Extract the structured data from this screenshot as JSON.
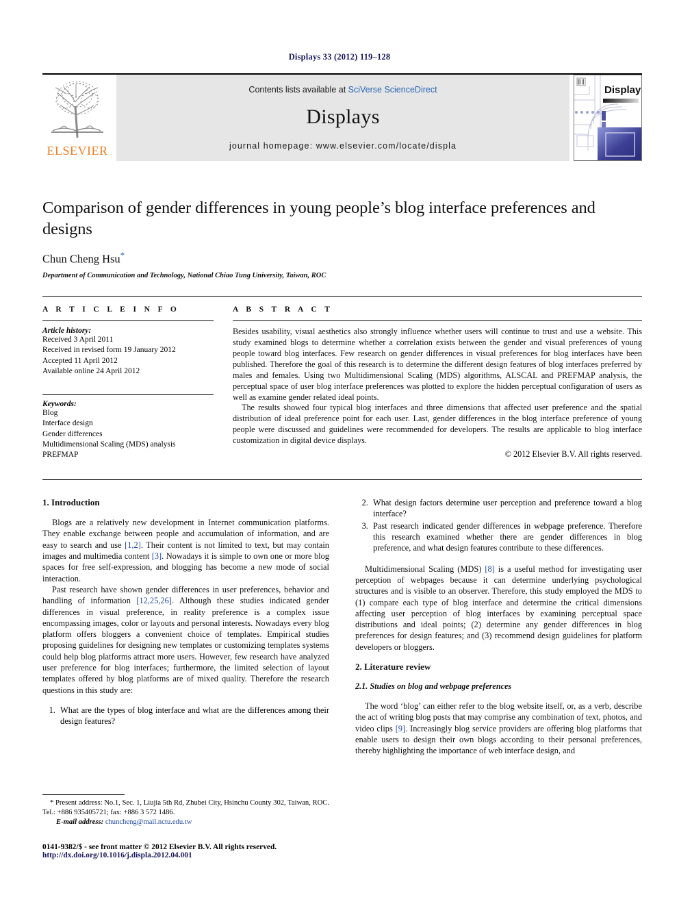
{
  "running_head": "Displays 33 (2012) 119–128",
  "masthead": {
    "publisher_wordmark": "ELSEVIER",
    "contents_prefix": "Contents lists available at ",
    "contents_link": "SciVerse ScienceDirect",
    "journal_name": "Displays",
    "homepage": "journal homepage: www.elsevier.com/locate/displa",
    "cover_title": "Displays"
  },
  "article": {
    "title": "Comparison of gender differences in young people’s blog interface preferences and designs",
    "author": "Chun Cheng Hsu",
    "author_marker": "*",
    "affiliation": "Department of Communication and Technology, National Chiao Tung University, Taiwan, ROC"
  },
  "info": {
    "heading": "A R T I C L E   I N F O",
    "history_label": "Article history:",
    "history": [
      "Received 3 April 2011",
      "Received in revised form 19 January 2012",
      "Accepted 11 April 2012",
      "Available online 24 April 2012"
    ],
    "keywords_label": "Keywords:",
    "keywords": [
      "Blog",
      "Interface design",
      "Gender differences",
      "Multidimensional Scaling (MDS) analysis",
      "PREFMAP"
    ]
  },
  "abstract": {
    "heading": "A B S T R A C T",
    "para1": "Besides usability, visual aesthetics also strongly influence whether users will continue to trust and use a website. This study examined blogs to determine whether a correlation exists between the gender and visual preferences of young people toward blog interfaces. Few research on gender differences in visual preferences for blog interfaces have been published. Therefore the goal of this research is to determine the different design features of blog interfaces preferred by males and females. Using two Multidimensional Scaling (MDS) algorithms, ALSCAL and PREFMAP analysis, the perceptual space of user blog interface preferences was plotted to explore the hidden perceptual configuration of users as well as examine gender related ideal points.",
    "para2": "The results showed four typical blog interfaces and three dimensions that affected user preference and the spatial distribution of ideal preference point for each user. Last, gender differences in the blog interface preference of young people were discussed and guidelines were recommended for developers. The results are applicable to blog interface customization in digital device displays.",
    "copyright": "© 2012 Elsevier B.V. All rights reserved."
  },
  "body": {
    "intro_heading": "1. Introduction",
    "intro_p1_a": "Blogs are a relatively new development in Internet communication platforms. They enable exchange between people and accumulation of information, and are easy to search and use ",
    "intro_p1_cite1": "[1,2]",
    "intro_p1_b": ". Their content is not limited to text, but may contain images and multimedia content ",
    "intro_p1_cite2": "[3]",
    "intro_p1_c": ". Nowadays it is simple to own one or more blog spaces for free self-expression, and blogging has become a new mode of social interaction.",
    "intro_p2_a": "Past research have shown gender differences in user preferences, behavior and handling of information ",
    "intro_p2_cite": "[12,25,26]",
    "intro_p2_b": ". Although these studies indicated gender differences in visual preference, in reality preference is a complex issue encompassing images, color or layouts and personal interests. Nowadays every blog platform offers bloggers a convenient choice of templates. Empirical studies proposing guidelines for designing new templates or customizing templates systems could help blog platforms attract more users. However, few research have analyzed user preference for blog interfaces; furthermore, the limited selection of layout templates offered by blog platforms are of mixed quality. Therefore the research questions in this study are:",
    "questions": [
      "What are the types of blog interface and what are the differences among their design features?",
      "What design factors determine user perception and preference toward a blog interface?",
      "Past research indicated gender differences in webpage preference. Therefore this research examined whether there are gender differences in blog preference, and what design features contribute to these differences."
    ],
    "mds_p_a": "Multidimensional Scaling (MDS) ",
    "mds_p_cite": "[8]",
    "mds_p_b": " is a useful method for investigating user perception of webpages because it can determine underlying psychological structures and is visible to an observer. Therefore, this study employed the MDS to (1) compare each type of blog interface and determine the critical dimensions affecting user perception of blog interfaces by examining perceptual space distributions and ideal points; (2) determine any gender differences in blog preferences for design features; and (3) recommend design guidelines for platform developers or bloggers.",
    "lit_heading": "2. Literature review",
    "lit_sub_heading": "2.1. Studies on blog and webpage preferences",
    "lit_p_a": "The word ‘blog’ can either refer to the blog website itself, or, as a verb, describe the act of writing blog posts that may comprise any combination of text, photos, and video clips ",
    "lit_p_cite": "[9]",
    "lit_p_b": ". Increasingly blog service providers are offering blog platforms that enable users to design their own blogs according to their personal preferences, thereby highlighting the importance of web interface design, and"
  },
  "footnote": {
    "text": "* Present address: No.1, Sec. 1, Liujia 5th Rd, Zhubei City, Hsinchu County 302, Taiwan, ROC. Tel.: +886 935405721; fax: +886 3 572 1486.",
    "email_label": "E-mail address:",
    "email": "chuncheng@mail.nctu.edu.tw"
  },
  "imprint": {
    "line1": "0141-9382/$ - see front matter © 2012 Elsevier B.V. All rights reserved.",
    "doi": "http://dx.doi.org/10.1016/j.displa.2012.04.001"
  },
  "colors": {
    "running_head": "#18195c",
    "link": "#2a64b4",
    "citation": "#2348a0",
    "elsevier_orange": "#ef7d22",
    "banner_bg": "#e6e6e6"
  }
}
